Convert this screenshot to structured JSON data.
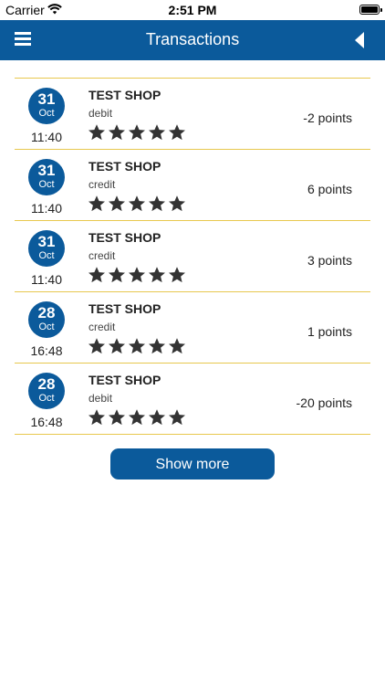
{
  "status_bar": {
    "carrier": "Carrier",
    "time": "2:51 PM",
    "wifi_icon": "wifi-icon",
    "battery_icon": "battery-icon"
  },
  "nav": {
    "title": "Transactions",
    "menu_icon": "hamburger-menu-icon",
    "back_icon": "back-arrow-icon"
  },
  "colors": {
    "primary": "#0b5a9b",
    "divider": "#e8c84e",
    "star": "#333333"
  },
  "transactions": [
    {
      "day": "31",
      "month": "Oct",
      "time": "11:40",
      "shop": "TEST SHOP",
      "type": "debit",
      "points": "-2 points",
      "rating": 5
    },
    {
      "day": "31",
      "month": "Oct",
      "time": "11:40",
      "shop": "TEST SHOP",
      "type": "credit",
      "points": "6 points",
      "rating": 5
    },
    {
      "day": "31",
      "month": "Oct",
      "time": "11:40",
      "shop": "TEST SHOP",
      "type": "credit",
      "points": "3 points",
      "rating": 5
    },
    {
      "day": "28",
      "month": "Oct",
      "time": "16:48",
      "shop": "TEST SHOP",
      "type": "credit",
      "points": "1 points",
      "rating": 5
    },
    {
      "day": "28",
      "month": "Oct",
      "time": "16:48",
      "shop": "TEST SHOP",
      "type": "debit",
      "points": "-20 points",
      "rating": 5
    }
  ],
  "show_more_label": "Show more"
}
